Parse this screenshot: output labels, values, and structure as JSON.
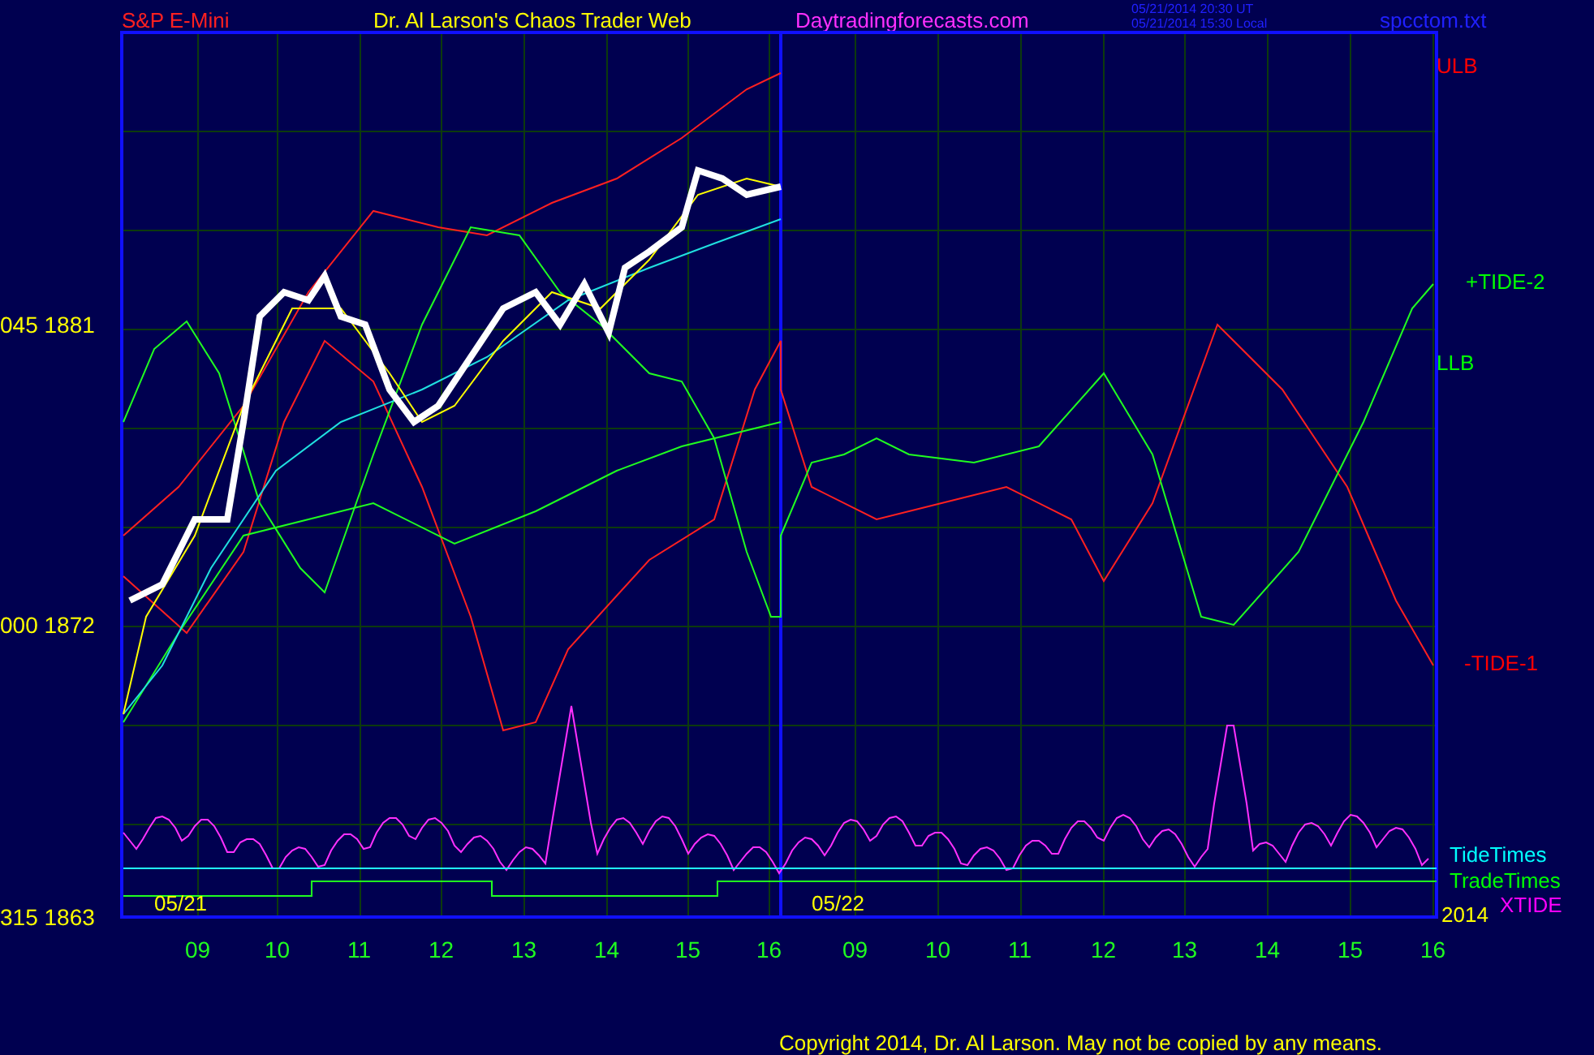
{
  "header": {
    "instrument": "S&P E-Mini",
    "site_title": "Dr. Al Larson's Chaos Trader Web",
    "website": "Daytradingforecasts.com",
    "timestamp_ut": "05/21/2014 20:30 UT",
    "timestamp_local": "05/21/2014 15:30 Local",
    "file_name": "spcctom.txt"
  },
  "price_axis": [
    "045  1881",
    "000  1872",
    "315  1863"
  ],
  "curve_labels": [
    {
      "text": "ULB",
      "color": "#ff0000"
    },
    {
      "text": "+TIDE-2",
      "color": "#00ff00"
    },
    {
      "text": "LLB",
      "color": "#00ff00"
    },
    {
      "text": "-TIDE-1",
      "color": "#ff0000"
    },
    {
      "text": "TideTimes",
      "color": "#00ffff"
    },
    {
      "text": "TradeTimes",
      "color": "#00ff00"
    },
    {
      "text": "XTIDE",
      "color": "#ff00ff"
    }
  ],
  "date_labels": [
    "05/21",
    "05/22"
  ],
  "year": "2014",
  "hour_labels": [
    "09",
    "10",
    "11",
    "12",
    "13",
    "14",
    "15",
    "16",
    "09",
    "10",
    "11",
    "12",
    "13",
    "14",
    "15",
    "16"
  ],
  "copyright": "Copyright 2014, Dr. Al Larson. May not be copied by any means."
}
